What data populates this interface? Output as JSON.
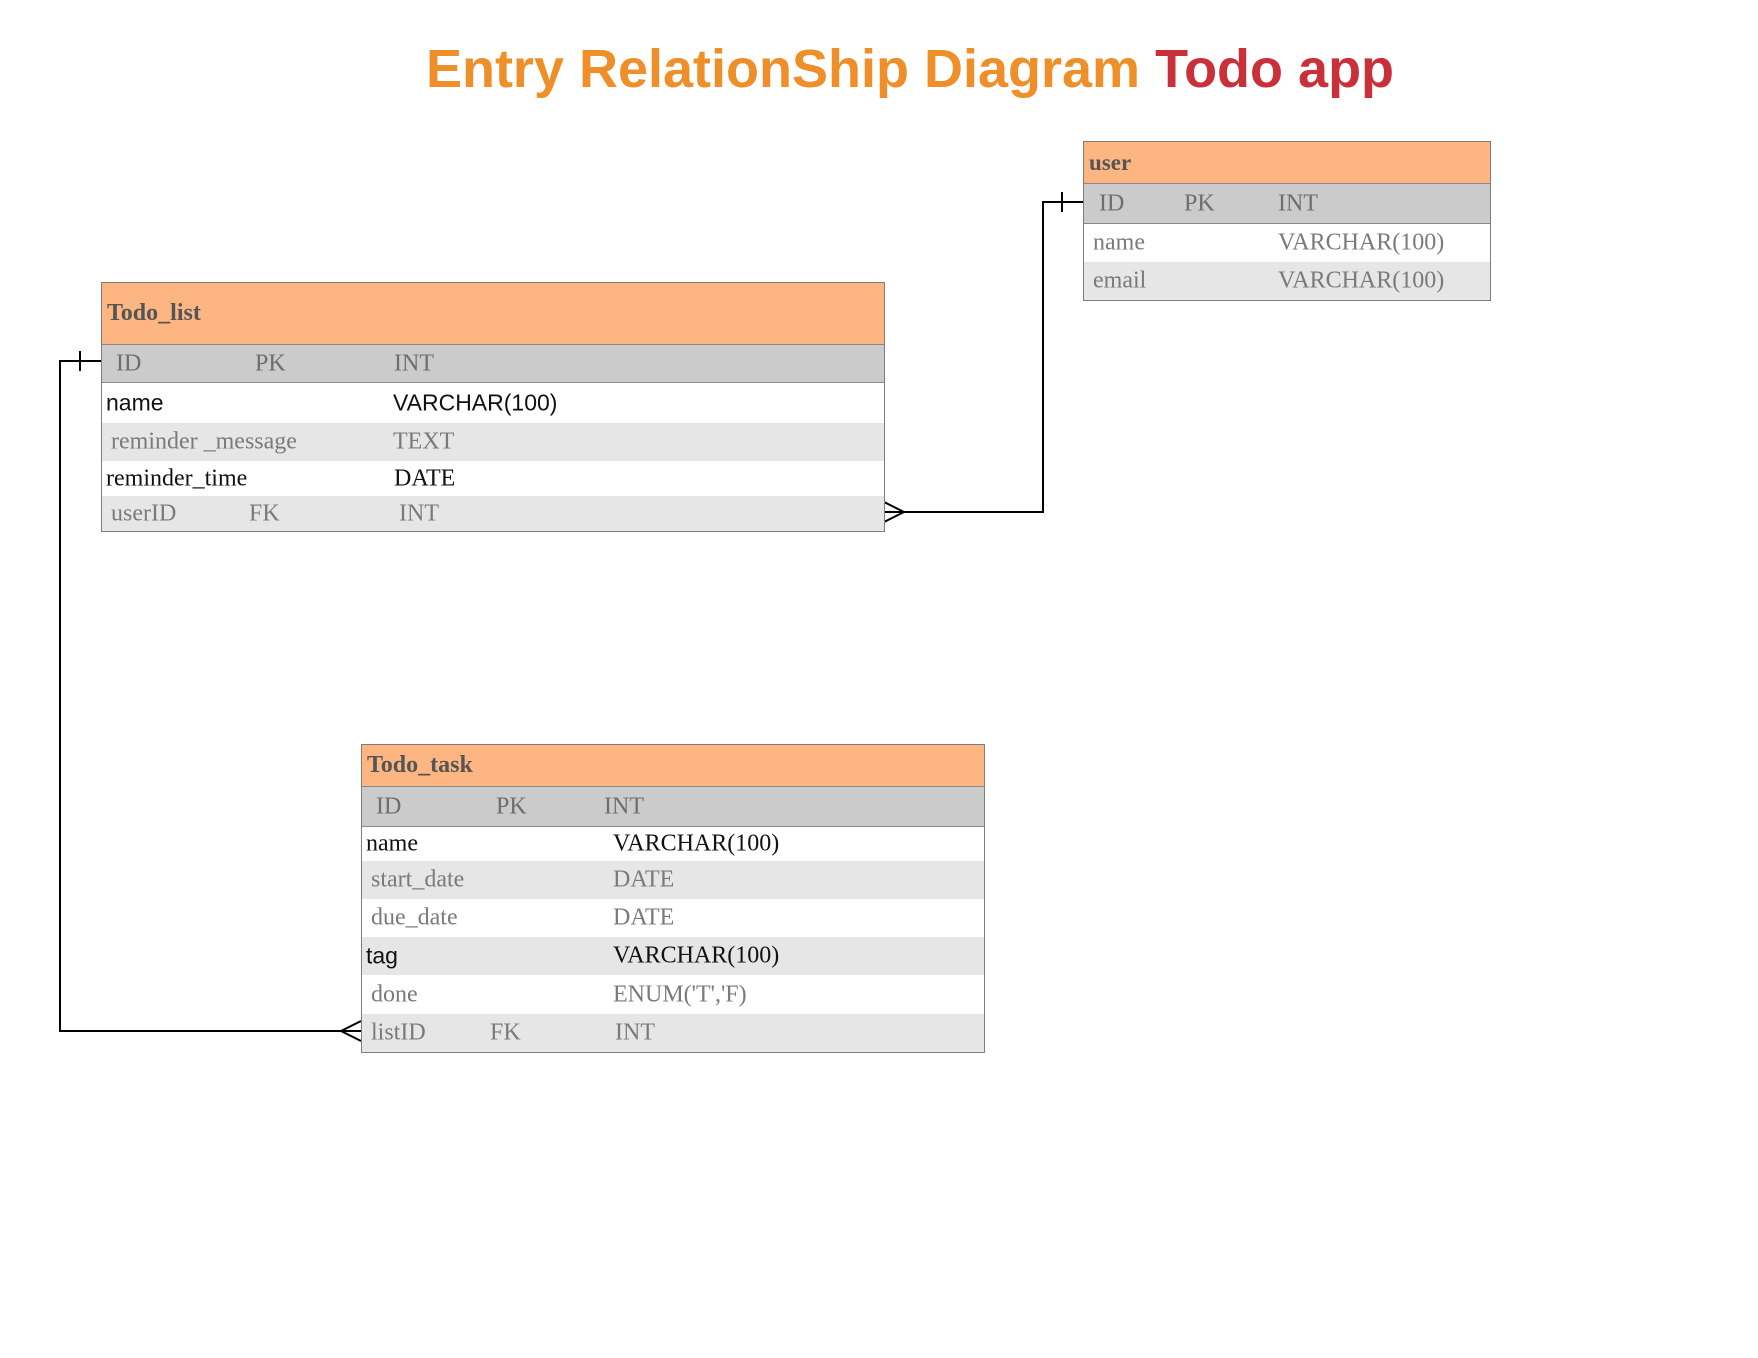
{
  "title": {
    "part1": "Entry RelationShip Diagram",
    "part2": "Todo app"
  },
  "colors": {
    "title_orange": "#ee8f2a",
    "title_red": "#c9303a",
    "header_fill": "#fdb682",
    "pk_fill": "#cbcbcb",
    "alt_fill": "#e6e6e6"
  },
  "user": {
    "name": "user",
    "pk": {
      "col": "ID",
      "key": "PK",
      "type": "INT"
    },
    "rows": [
      {
        "col": "name",
        "type": "VARCHAR(100)"
      },
      {
        "col": "email",
        "type": "VARCHAR(100)"
      }
    ]
  },
  "todo_list": {
    "name": "Todo_list",
    "pk": {
      "col": "ID",
      "key": "PK",
      "type": "INT"
    },
    "rows": [
      {
        "col": "name",
        "type": "VARCHAR(100)"
      },
      {
        "col": "reminder _message",
        "type": "TEXT"
      },
      {
        "col": "reminder_time",
        "type": "DATE"
      }
    ],
    "fk": {
      "col": "userID",
      "key": "FK",
      "type": "INT"
    }
  },
  "todo_task": {
    "name": "Todo_task",
    "pk": {
      "col": "ID",
      "key": "PK",
      "type": "INT"
    },
    "rows": [
      {
        "col": "name",
        "type": "VARCHAR(100)"
      },
      {
        "col": "start_date",
        "type": "DATE"
      },
      {
        "col": "due_date",
        "type": "DATE"
      },
      {
        "col": "tag",
        "type": "VARCHAR(100)"
      },
      {
        "col": "done",
        "type": "ENUM('T','F)"
      }
    ],
    "fk": {
      "col": "listID",
      "key": "FK",
      "type": "INT"
    }
  },
  "relationships": [
    {
      "from": "user.ID",
      "to": "Todo_list.userID",
      "cardinality": "one-to-many"
    },
    {
      "from": "Todo_list.ID",
      "to": "Todo_task.listID",
      "cardinality": "one-to-many"
    }
  ]
}
